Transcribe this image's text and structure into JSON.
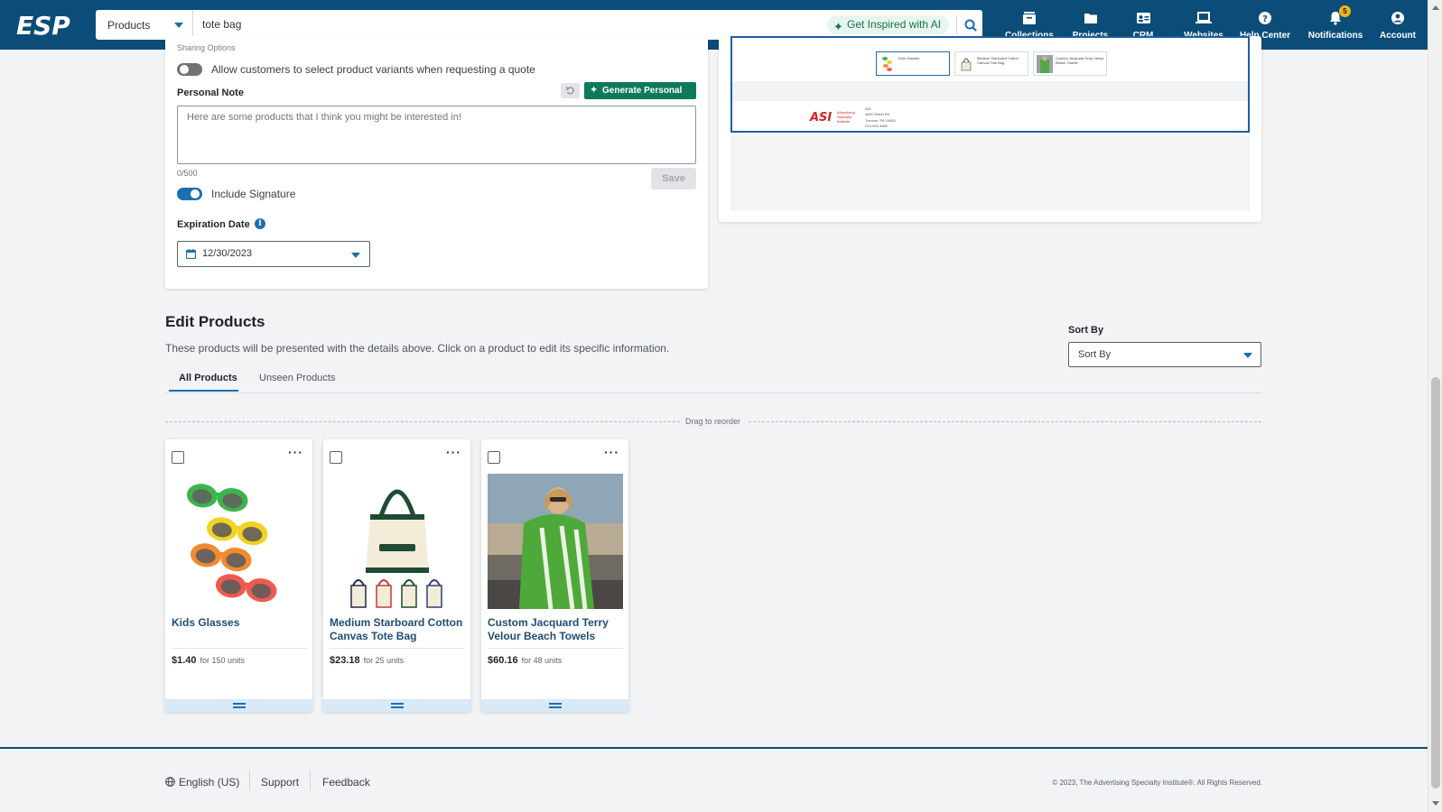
{
  "header": {
    "search_scope": "Products",
    "search_query": "tote bag",
    "ai_button": "Get Inspired with AI",
    "nav": [
      {
        "label": "Collections",
        "icon": "collections-icon"
      },
      {
        "label": "Projects",
        "icon": "folder-icon"
      },
      {
        "label": "CRM",
        "icon": "contact-card-icon"
      },
      {
        "label": "Websites",
        "icon": "laptop-icon"
      },
      {
        "label": "Help Center",
        "icon": "help-icon"
      },
      {
        "label": "Notifications",
        "icon": "bell-icon",
        "badge": "5"
      },
      {
        "label": "Account",
        "icon": "account-icon"
      }
    ]
  },
  "settings": {
    "sharing_options_label": "Sharing Options",
    "variants_toggle_label": "Allow customers to select product variants when requesting a quote",
    "variants_toggle_on": false,
    "personal_note_label": "Personal Note",
    "generate_note_button": "Generate Personal Note",
    "note_placeholder": "Here are some products that I think you might be interested in!",
    "char_counter": "0/500",
    "save_button": "Save",
    "signature_label": "Include Signature",
    "signature_on": true,
    "expiration_label": "Expiration Date",
    "expiration_value": "12/30/2023"
  },
  "preview": {
    "thumbs": [
      "Kids Glasses",
      "Medium Starboard Cotton Canvas Tote Bag",
      "Custom Jacquard Terry Velour Beach Towels"
    ],
    "company_logo": "ASI",
    "company_tagline": "Advertising Specialty Institute",
    "company_address": [
      "ASI",
      "4800 Street Rd",
      "Trevose, PA 19053",
      "215-953-3860"
    ]
  },
  "edit_products": {
    "title": "Edit Products",
    "description": "These products will be presented with the details above. Click on a product to edit its specific information.",
    "sort_label": "Sort By",
    "sort_value": "Sort By",
    "tabs": [
      "All Products",
      "Unseen Products"
    ],
    "active_tab": "All Products",
    "drag_hint": "Drag to reorder",
    "products": [
      {
        "name": "Kids Glasses",
        "price": "$1.40",
        "units": "for 150 units"
      },
      {
        "name": "Medium Starboard Cotton Canvas Tote Bag",
        "price": "$23.18",
        "units": "for 25 units"
      },
      {
        "name": "Custom Jacquard Terry Velour Beach Towels",
        "price": "$60.16",
        "units": "for 48 units"
      }
    ]
  },
  "footer": {
    "language": "English (US)",
    "support": "Support",
    "feedback": "Feedback",
    "copyright": "© 2023, The Advertising Specialty Institute®. All Rights Reserved."
  },
  "colors": {
    "header_bg": "#0b4d78",
    "primary_blue": "#1b6fb5",
    "generate_green": "#0e7a5a",
    "product_name": "#1f4d74"
  }
}
